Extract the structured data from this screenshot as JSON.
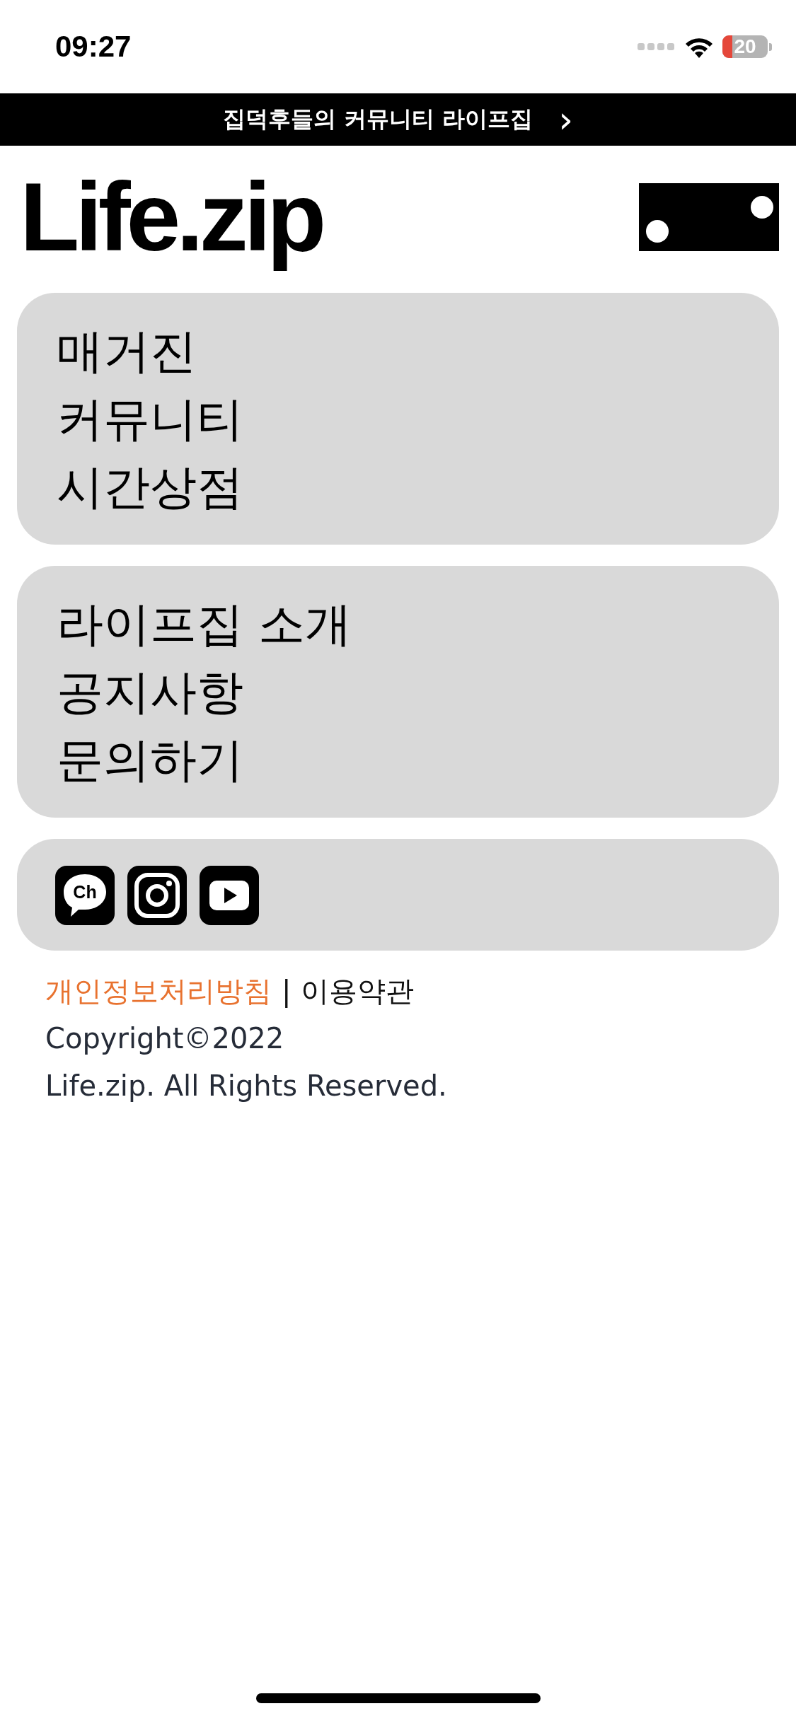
{
  "status_bar": {
    "time": "09:27",
    "battery": "20"
  },
  "banner": {
    "text": "집덕후들의 커뮤니티 라이프집",
    "arrow": "›"
  },
  "header": {
    "logo": "Life.zip"
  },
  "menu_groups": [
    {
      "items": [
        "매거진",
        "커뮤니티",
        "시간상점"
      ]
    },
    {
      "items": [
        "라이프집 소개",
        "공지사항",
        "문의하기"
      ]
    }
  ],
  "social": [
    {
      "kind": "channel",
      "label": "Ch"
    },
    {
      "kind": "instagram"
    },
    {
      "kind": "youtube"
    }
  ],
  "footer": {
    "links": [
      {
        "label": "개인정보처리방침",
        "highlighted": true
      },
      {
        "label": "이용약관",
        "highlighted": false
      }
    ],
    "separator": "|",
    "copyright": [
      "Copyright©2022",
      "Life.zip. All Rights Reserved."
    ]
  }
}
